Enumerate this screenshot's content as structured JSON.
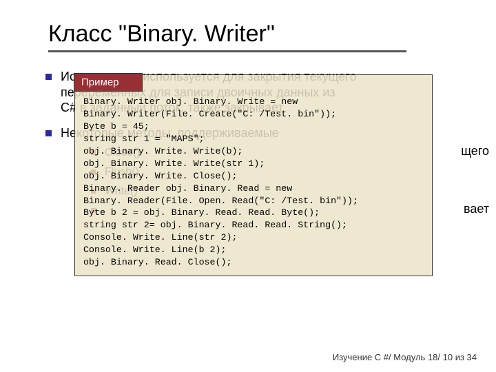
{
  "title": "Класс \"Binary. Writer\"",
  "bullets": [
    {
      "text_line1": "Используется                    используется для закрытия текущего",
      "text_line2": "переременных      для записи двоичных данных из",
      "text_line3": "                           C# в заданный поток.  также закрывает"
    },
    {
      "text": "Некоторые методы, поддерживаемые",
      "trail": "                                                                                               щего",
      "trail2": "                                                                                             вает",
      "subs": [
        "Close()",
        "Flush()",
        "Write()",
        ""
      ]
    }
  ],
  "example": {
    "label": "Пример",
    "code": "Binary. Writer obj. Binary. Write = new\nBinary. Writer(File. Create(\"C: /Test. bin\"));\nByte b = 45;\nstring str 1 = \"MAPS\";\nobj. Binary. Write. Write(b);\nobj. Binary. Write. Write(str 1);\nobj. Binary. Write. Close();\nBinary. Reader obj. Binary. Read = new\nBinary. Reader(File. Open. Read(\"C: /Test. bin\"));\nByte b 2 = obj. Binary. Read. Read. Byte();\nstring str 2= obj. Binary. Read. Read. String();\nConsole. Write. Line(str 2);\nConsole. Write. Line(b 2);\nobj. Binary. Read. Close();"
  },
  "footer": "Изучение C #/ Модуль 18/ 10 из 34"
}
